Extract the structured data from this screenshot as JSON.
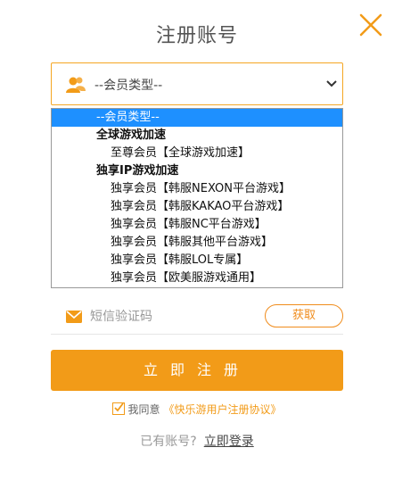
{
  "title": "注册账号",
  "member_select": {
    "selected_label": "--会员类型--",
    "icon": "user-group-icon",
    "chevron": "chevron-down-icon"
  },
  "dropdown": {
    "items": [
      {
        "type": "selected",
        "label": "--会员类型--"
      },
      {
        "type": "group",
        "label": "全球游戏加速"
      },
      {
        "type": "option",
        "label": "至尊会员【全球游戏加速】"
      },
      {
        "type": "group",
        "label": "独享IP游戏加速"
      },
      {
        "type": "option",
        "label": "独享会员【韩服NEXON平台游戏】"
      },
      {
        "type": "option",
        "label": "独享会员【韩服KAKAO平台游戏】"
      },
      {
        "type": "option",
        "label": "独享会员【韩服NC平台游戏】"
      },
      {
        "type": "option",
        "label": "独享会员【韩服其他平台游戏】"
      },
      {
        "type": "option",
        "label": "独享会员【韩服LOL专属】"
      },
      {
        "type": "option",
        "label": "独享会员【欧美服游戏通用】"
      }
    ]
  },
  "sms": {
    "placeholder": "短信验证码",
    "get_code_label": "获取",
    "icon": "mail-icon"
  },
  "register_label": "立即注册",
  "agreement": {
    "prefix": "我同意",
    "link_text": "《快乐游用户注册协议》",
    "checked": true
  },
  "login": {
    "prompt": "已有账号?",
    "link_text": "立即登录"
  },
  "colors": {
    "accent": "#f29b18",
    "selected_highlight": "#1e90ff"
  }
}
